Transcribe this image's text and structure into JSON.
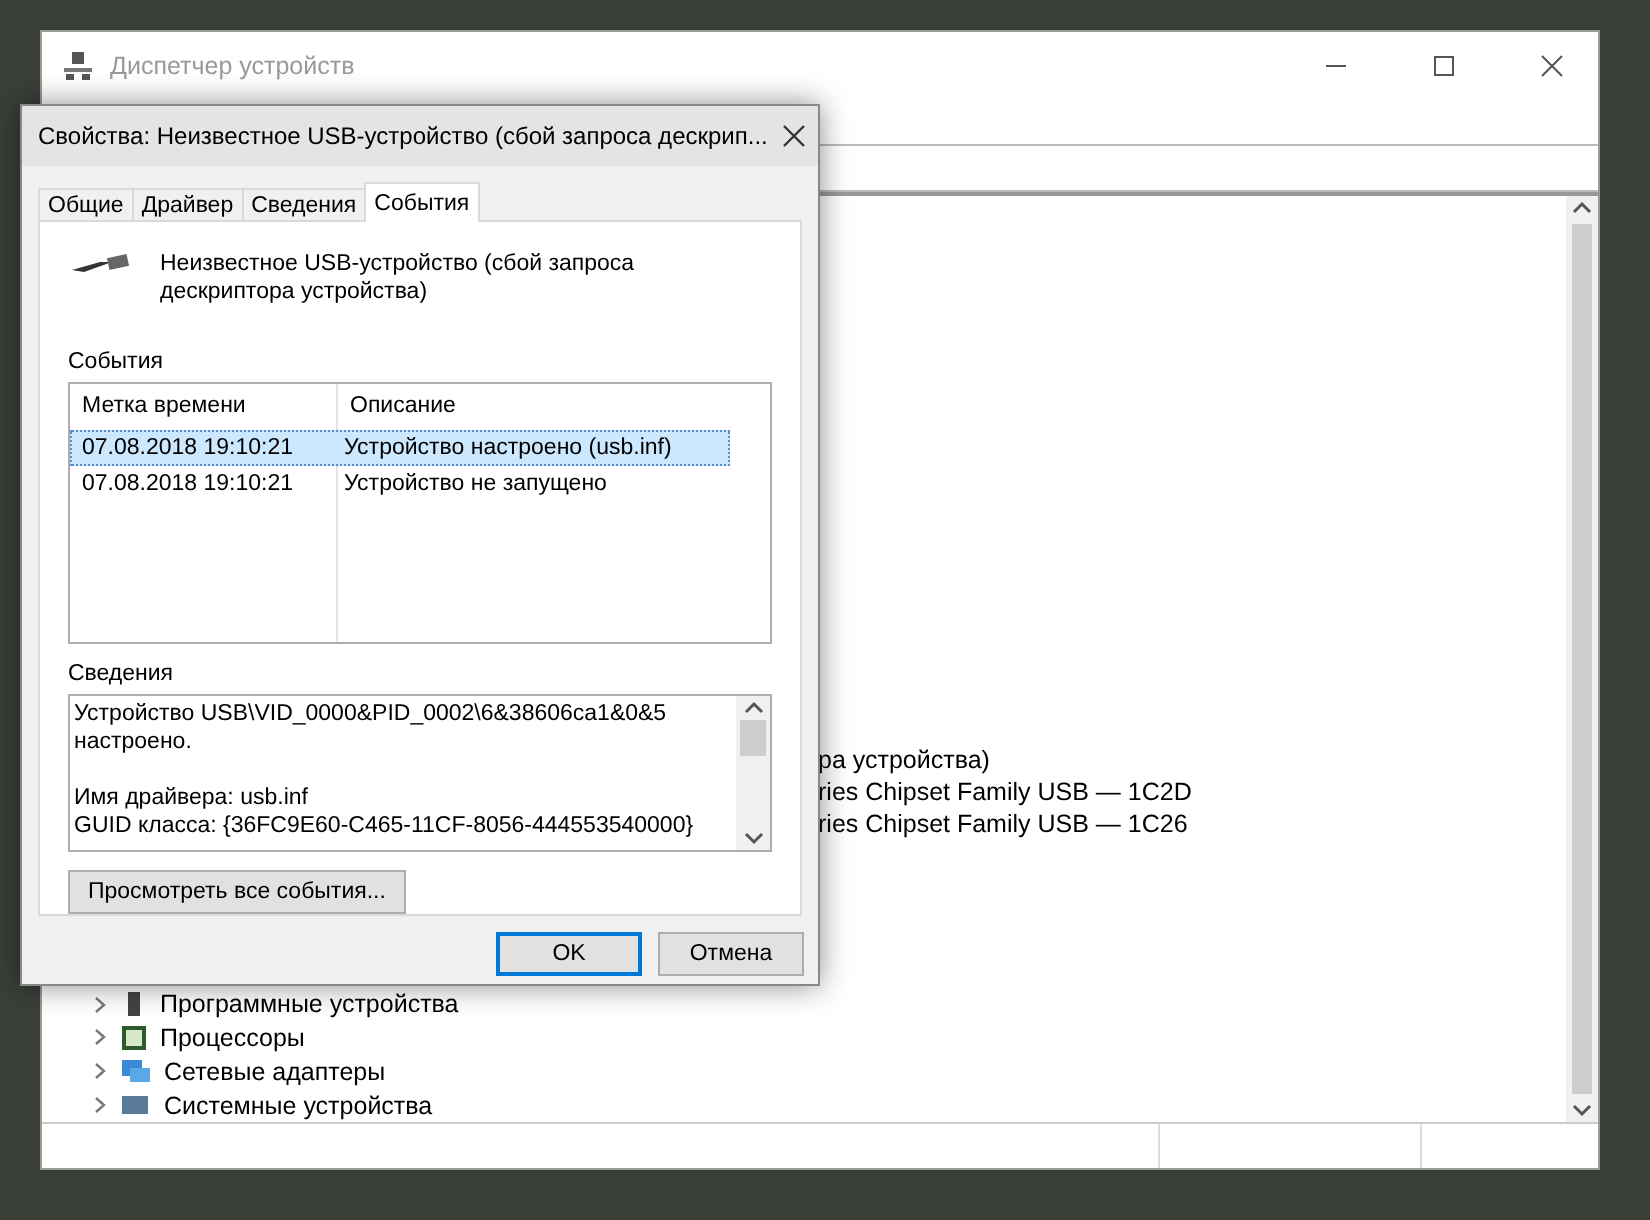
{
  "main_window": {
    "title": "Диспетчер устройств",
    "tree_partial": [
      "ра устройства)",
      "ries Chipset Family USB — 1C2D",
      "ries Chipset Family USB — 1C26"
    ],
    "tree": [
      {
        "label": "Программные устройства",
        "kind": "software"
      },
      {
        "label": "Процессоры",
        "kind": "cpu"
      },
      {
        "label": "Сетевые адаптеры",
        "kind": "network"
      },
      {
        "label": "Системные устройства",
        "kind": "system"
      }
    ]
  },
  "dialog": {
    "title": "Свойства: Неизвестное USB-устройство (сбой запроса дескрип...",
    "tabs": [
      {
        "label": "Общие",
        "selected": false
      },
      {
        "label": "Драйвер",
        "selected": false
      },
      {
        "label": "Сведения",
        "selected": false
      },
      {
        "label": "События",
        "selected": true
      }
    ],
    "device_name": "Неизвестное USB-устройство (сбой запроса дескриптора устройства)",
    "events_label": "События",
    "columns": [
      "Метка времени",
      "Описание"
    ],
    "rows": [
      {
        "time": "07.08.2018 19:10:21",
        "description": "Устройство настроено (usb.inf)",
        "selected": true
      },
      {
        "time": "07.08.2018 19:10:21",
        "description": "Устройство не запущено",
        "selected": false
      }
    ],
    "details_label": "Сведения",
    "details_paragraphs": [
      [
        "Устройство USB\\VID_0000&PID_0002\\6&38606ca1&0&5",
        "настроено."
      ],
      [
        "Имя драйвера: usb.inf",
        "GUID класса: {36FC9E60-C465-11CF-8056-444553540000}"
      ]
    ],
    "view_all_button": "Просмотреть все события...",
    "buttons": [
      {
        "label": "OK",
        "kind": "default"
      },
      {
        "label": "Отмена",
        "kind": "normal"
      }
    ]
  }
}
